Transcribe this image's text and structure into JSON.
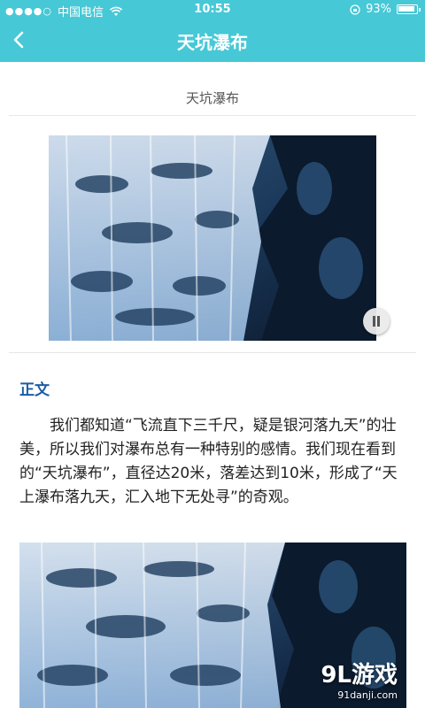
{
  "status_bar": {
    "signal": "●●●●○",
    "carrier": "中国电信",
    "wifi_icon": "wifi-icon",
    "time": "10:55",
    "battery_percent": "93%",
    "battery_level": 0.93
  },
  "navbar": {
    "back_icon": "chevron-left-icon",
    "back_glyph": "‹",
    "title": "天坑瀑布"
  },
  "article": {
    "subtitle": "天坑瀑布",
    "section_title": "正文",
    "paragraph": "我们都知道“飞流直下三千尺，疑是银河落九天”的壮美，所以我们对瀑布总有一种特别的感情。我们现在看到的“天坑瀑布”，直径达20米，落差达到10米，形成了“天上瀑布落九天，汇入地下无处寻”的奇观。"
  },
  "media": {
    "pause_icon": "pause-icon"
  },
  "watermark": {
    "main": "9L游戏",
    "sub": "91danji.com"
  },
  "colors": {
    "header": "#46c8d6",
    "section_title": "#1a5ca8"
  }
}
